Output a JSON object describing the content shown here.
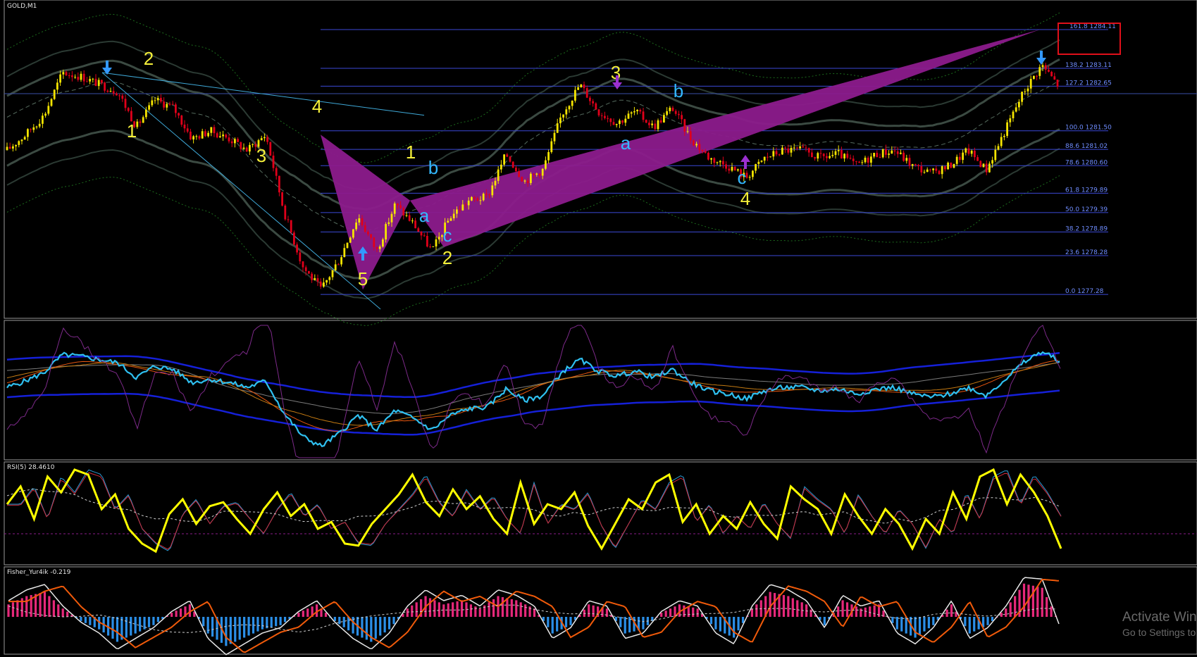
{
  "main": {
    "symbol_title": "GOLD,M1",
    "fib_levels": [
      {
        "pct": "161.8",
        "price": "1284.11",
        "highlight": true
      },
      {
        "pct": "138.2",
        "price": "1283.11"
      },
      {
        "pct": "127.2",
        "price": "1282.65"
      },
      {
        "pct": "100.0",
        "price": "1281.50"
      },
      {
        "pct": "88.6",
        "price": "1281.02"
      },
      {
        "pct": "78.6",
        "price": "1280.60"
      },
      {
        "pct": "61.8",
        "price": "1279.89"
      },
      {
        "pct": "50.0",
        "price": "1279.39"
      },
      {
        "pct": "38.2",
        "price": "1278.89"
      },
      {
        "pct": "23.6",
        "price": "1278.28"
      },
      {
        "pct": "0.0",
        "price": "1277.28"
      }
    ],
    "wave_labels": [
      {
        "text": "2",
        "color": "#f5f03a"
      },
      {
        "text": "1",
        "color": "#f5f03a"
      },
      {
        "text": "3",
        "color": "#f5f03a"
      },
      {
        "text": "4",
        "color": "#f5f03a"
      },
      {
        "text": "5",
        "color": "#f5f03a"
      },
      {
        "text": "1",
        "color": "#f5f03a"
      },
      {
        "text": "b",
        "color": "#33b8ff"
      },
      {
        "text": "a",
        "color": "#33b8ff"
      },
      {
        "text": "c",
        "color": "#33b8ff"
      },
      {
        "text": "2",
        "color": "#f5f03a"
      },
      {
        "text": "3",
        "color": "#f5f03a"
      },
      {
        "text": "b",
        "color": "#33b8ff"
      },
      {
        "text": "a",
        "color": "#33b8ff"
      },
      {
        "text": "c",
        "color": "#33b8ff"
      },
      {
        "text": "4",
        "color": "#f5f03a"
      }
    ],
    "arrows": [
      "down-arrow-icon",
      "up-arrow-icon",
      "down-arrow-icon"
    ]
  },
  "rsi_panel": {
    "title": "RSI(5) 28.4610"
  },
  "fisher_panel": {
    "title": "Fisher_Yur4ik -0.219"
  },
  "watermark": {
    "line1": "Activate Win",
    "line2": "Go to Settings to"
  },
  "colors": {
    "background": "#000000",
    "bull_candle": "#f5e400",
    "bear_candle": "#e0001a",
    "fib_line": "#3b49d6",
    "harmonic_fill": "#8c1b8c",
    "rsi_line": "#ffff00",
    "fisher_pos_hist": "#e6287a",
    "fisher_neg_hist": "#2b8fe8"
  },
  "chart_data": [
    {
      "type": "candlestick",
      "title": "GOLD,M1",
      "ylim": [
        1276.7,
        1284.8
      ],
      "close_path": [
        1281.0,
        1281.4,
        1281.9,
        1283.0,
        1282.9,
        1282.7,
        1282.5,
        1281.6,
        1282.3,
        1282.1,
        1281.3,
        1281.5,
        1281.3,
        1281.0,
        1281.4,
        1279.4,
        1278.0,
        1277.4,
        1278.2,
        1279.3,
        1278.4,
        1279.6,
        1279.1,
        1278.4,
        1279.3,
        1279.7,
        1279.8,
        1280.9,
        1280.2,
        1280.5,
        1281.9,
        1282.7,
        1282.0,
        1281.7,
        1282.0,
        1281.6,
        1282.1,
        1281.3,
        1280.8,
        1280.6,
        1280.3,
        1280.8,
        1281.0,
        1281.0,
        1280.8,
        1280.9,
        1280.6,
        1280.9,
        1281.0,
        1280.6,
        1280.4,
        1280.6,
        1281.0,
        1280.5,
        1281.5,
        1282.5,
        1283.2,
        1282.6
      ]
    },
    {
      "type": "line",
      "title": "",
      "ylim": [
        0,
        100
      ],
      "series": [
        {
          "name": "",
          "values": [
            60,
            78,
            45,
            88,
            72,
            95,
            90,
            55,
            70,
            35,
            20,
            12,
            50,
            65,
            40,
            58,
            62,
            45,
            30,
            55,
            72,
            48,
            60,
            35,
            42,
            20,
            18,
            40,
            55,
            70,
            90,
            62,
            48,
            75,
            55,
            68,
            45,
            30,
            82,
            40,
            60,
            55,
            72,
            38,
            15,
            40,
            65,
            55,
            82,
            90,
            42,
            60,
            30,
            48,
            35,
            62,
            40,
            25,
            78,
            65,
            55,
            30,
            70,
            48,
            30,
            55,
            40,
            15,
            45,
            30,
            72,
            45,
            88,
            95,
            60,
            90,
            72,
            48,
            15
          ]
        }
      ]
    },
    {
      "type": "bar",
      "title": "",
      "ylim": [
        -1,
        1
      ],
      "values": [
        0.3,
        0.5,
        0.6,
        0.2,
        -0.1,
        -0.3,
        -0.6,
        -0.4,
        -0.2,
        0.1,
        0.3,
        -0.4,
        -0.7,
        -0.5,
        -0.3,
        -0.2,
        0.1,
        0.3,
        -0.1,
        -0.4,
        -0.6,
        -0.3,
        0.2,
        0.5,
        0.3,
        0.4,
        0.2,
        0.5,
        0.4,
        0.2,
        -0.4,
        -0.2,
        0.3,
        0.2,
        -0.4,
        -0.3,
        0.1,
        0.3,
        0.2,
        -0.3,
        -0.5,
        0.2,
        0.6,
        0.5,
        0.3,
        -0.2,
        0.4,
        0.2,
        0.3,
        -0.3,
        -0.5,
        -0.2,
        0.3,
        -0.4,
        -0.2,
        0.2,
        0.8,
        0.7,
        -0.2
      ]
    }
  ]
}
